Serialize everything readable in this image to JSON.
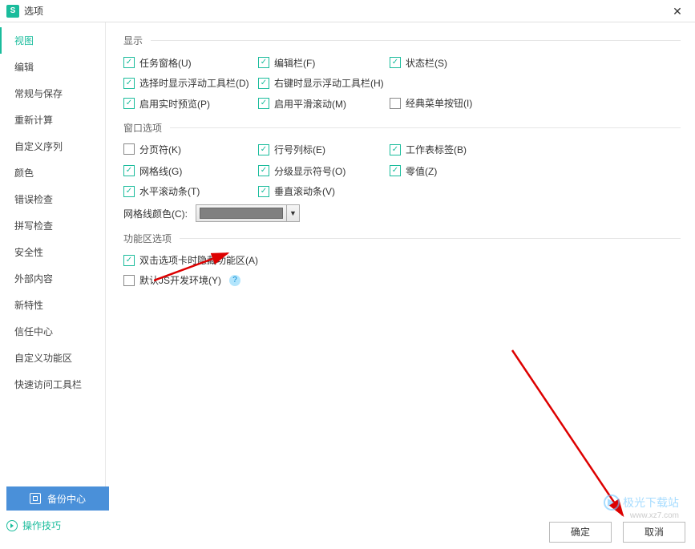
{
  "title": "选项",
  "sidebar": {
    "items": [
      {
        "label": "视图",
        "active": true
      },
      {
        "label": "编辑"
      },
      {
        "label": "常规与保存"
      },
      {
        "label": "重新计算"
      },
      {
        "label": "自定义序列"
      },
      {
        "label": "颜色"
      },
      {
        "label": "错误检查"
      },
      {
        "label": "拼写检查"
      },
      {
        "label": "安全性"
      },
      {
        "label": "外部内容"
      },
      {
        "label": "新特性"
      },
      {
        "label": "信任中心"
      },
      {
        "label": "自定义功能区"
      },
      {
        "label": "快速访问工具栏"
      }
    ]
  },
  "sections": {
    "display": {
      "title": "显示",
      "options": [
        [
          {
            "label": "任务窗格(U)",
            "checked": true
          },
          {
            "label": "编辑栏(F)",
            "checked": true
          },
          {
            "label": "状态栏(S)",
            "checked": true
          }
        ],
        [
          {
            "label": "选择时显示浮动工具栏(D)",
            "checked": true
          },
          {
            "label": "右键时显示浮动工具栏(H)",
            "checked": true
          }
        ],
        [
          {
            "label": "启用实时预览(P)",
            "checked": true
          },
          {
            "label": "启用平滑滚动(M)",
            "checked": true
          },
          {
            "label": "经典菜单按钮(I)",
            "checked": false
          }
        ]
      ]
    },
    "window": {
      "title": "窗口选项",
      "options": [
        [
          {
            "label": "分页符(K)",
            "checked": false
          },
          {
            "label": "行号列标(E)",
            "checked": true
          },
          {
            "label": "工作表标签(B)",
            "checked": true
          }
        ],
        [
          {
            "label": "网格线(G)",
            "checked": true
          },
          {
            "label": "分级显示符号(O)",
            "checked": true
          },
          {
            "label": "零值(Z)",
            "checked": true
          }
        ],
        [
          {
            "label": "水平滚动条(T)",
            "checked": true
          },
          {
            "label": "垂直滚动条(V)",
            "checked": true
          }
        ]
      ],
      "gridColorLabel": "网格线颜色(C):",
      "gridColor": "#808080"
    },
    "ribbon": {
      "title": "功能区选项",
      "options": [
        {
          "label": "双击选项卡时隐藏功能区(A)",
          "checked": true
        },
        {
          "label": "默认JS开发环境(Y)",
          "checked": false,
          "help": true
        }
      ]
    }
  },
  "footer": {
    "backup": "备份中心",
    "tips": "操作技巧",
    "ok": "确定",
    "cancel": "取消"
  },
  "watermark": {
    "text": "极光下载站",
    "url": "www.xz7.com"
  }
}
